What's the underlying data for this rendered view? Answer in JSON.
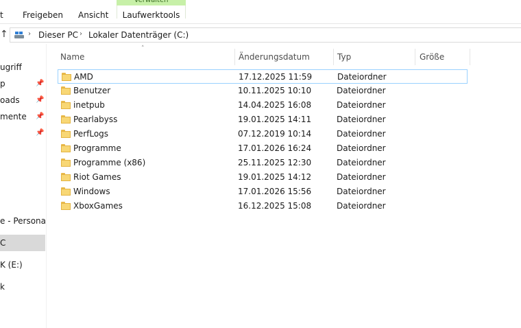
{
  "ribbon": {
    "tabs": [
      "t",
      "Freigeben",
      "Ansicht"
    ],
    "context_header": "Verwalten",
    "context_tab": "Laufwerktools",
    "accent": "#c7f0a8"
  },
  "address": {
    "up_icon": "up-arrow-icon",
    "crumbs": [
      "Dieser PC",
      "Lokaler Datenträger (C:)"
    ]
  },
  "nav": {
    "items": [
      {
        "label": "ugriff",
        "pinned": false
      },
      {
        "label": "p",
        "pinned": true
      },
      {
        "label": "oads",
        "pinned": true
      },
      {
        "label": "mente",
        "pinned": true
      },
      {
        "label": "",
        "pinned": true
      },
      {
        "label": "e - Personal",
        "pinned": false
      },
      {
        "label": "C",
        "pinned": false,
        "selected": true
      },
      {
        "label": "K (E:)",
        "pinned": false
      },
      {
        "label": "k",
        "pinned": false
      }
    ]
  },
  "columns": [
    "Name",
    "Änderungsdatum",
    "Typ",
    "Größe"
  ],
  "files": [
    {
      "name": "AMD",
      "date": "17.12.2025 11:59",
      "type": "Dateiordner"
    },
    {
      "name": "Benutzer",
      "date": "10.11.2025 10:10",
      "type": "Dateiordner"
    },
    {
      "name": "inetpub",
      "date": "14.04.2025 16:08",
      "type": "Dateiordner"
    },
    {
      "name": "Pearlabyss",
      "date": "19.01.2025 14:11",
      "type": "Dateiordner"
    },
    {
      "name": "PerfLogs",
      "date": "07.12.2019 10:14",
      "type": "Dateiordner"
    },
    {
      "name": "Programme",
      "date": "17.01.2026 16:24",
      "type": "Dateiordner"
    },
    {
      "name": "Programme (x86)",
      "date": "25.11.2025 12:30",
      "type": "Dateiordner"
    },
    {
      "name": "Riot Games",
      "date": "19.01.2025 14:12",
      "type": "Dateiordner"
    },
    {
      "name": "Windows",
      "date": "17.01.2026 15:56",
      "type": "Dateiordner"
    },
    {
      "name": "XboxGames",
      "date": "16.12.2025 15:08",
      "type": "Dateiordner"
    }
  ]
}
